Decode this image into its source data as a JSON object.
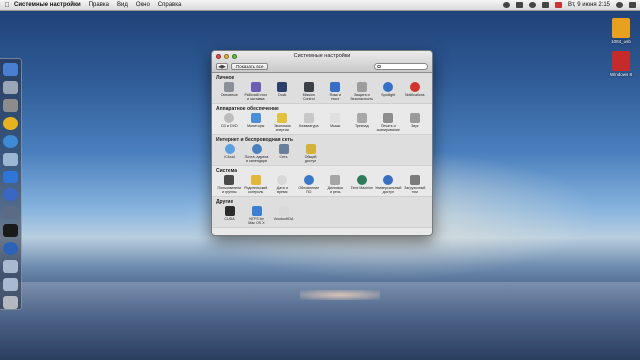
{
  "menubar": {
    "app_name": "Системные настройки",
    "menus": [
      "Правка",
      "Вид",
      "Окно",
      "Справка"
    ],
    "clock": "Вт, 9 июня  2:15"
  },
  "desktop": {
    "items": [
      {
        "label": "1084_usb",
        "icon": "drive-icon",
        "color": "#e8a020"
      },
      {
        "label": "Windows 8",
        "icon": "windows-app-icon",
        "color": "#c62b2b"
      }
    ]
  },
  "dock": {
    "icons": [
      {
        "name": "finder-icon",
        "color": "#4a7fd0"
      },
      {
        "name": "launchpad-icon",
        "color": "#9aa6b6"
      },
      {
        "name": "system-preferences-icon",
        "color": "#8c8c8c"
      },
      {
        "name": "chrome-icon",
        "color": "#e6b21f"
      },
      {
        "name": "safari-icon",
        "color": "#3f8ad4"
      },
      {
        "name": "mail-icon",
        "color": "#9cb7d6"
      },
      {
        "name": "app-store-icon",
        "color": "#2f75d6"
      },
      {
        "name": "itunes-icon",
        "color": "#3a66c4"
      },
      {
        "name": "utilities-icon",
        "color": "#5b6b85"
      },
      {
        "name": "terminal-icon",
        "color": "#1a1a1a"
      },
      {
        "name": "globe-icon",
        "color": "#2d62b6"
      },
      {
        "name": "applications-folder-icon",
        "color": "#a9b9cf"
      },
      {
        "name": "documents-folder-icon",
        "color": "#a9b9cf"
      },
      {
        "name": "trash-icon",
        "color": "#b5b9bf"
      }
    ]
  },
  "window": {
    "title": "Системные настройки",
    "show_all": "Показать все",
    "search_value": "",
    "sections": [
      {
        "title": "Личное",
        "items": [
          {
            "label": "Основные",
            "icon": "general-icon",
            "color": "#8a8f98"
          },
          {
            "label": "Рабочий стол\nи заставка",
            "icon": "desktop-icon",
            "color": "#6b5fb5"
          },
          {
            "label": "Dock",
            "icon": "dock-icon",
            "color": "#2d3f6b"
          },
          {
            "label": "Mission\nControl",
            "icon": "mission-control-icon",
            "color": "#3c3f45"
          },
          {
            "label": "Язык и\nтекст",
            "icon": "flag-icon",
            "color": "#3a6fc8"
          },
          {
            "label": "Защита и\nбезопасность",
            "icon": "house-lock-icon",
            "color": "#9d9d9d"
          },
          {
            "label": "Spotlight",
            "icon": "spotlight-icon",
            "color": "#3570c8"
          },
          {
            "label": "Notifications",
            "icon": "notifications-icon",
            "color": "#d0342c"
          }
        ]
      },
      {
        "title": "Аппаратное обеспечение",
        "items": [
          {
            "label": "CD и DVD",
            "icon": "cd-icon",
            "color": "#bcbcbc"
          },
          {
            "label": "Мониторы",
            "icon": "monitor-icon",
            "color": "#4b8fd6"
          },
          {
            "label": "Экономия\nэнергии",
            "icon": "bulb-icon",
            "color": "#e2c23a"
          },
          {
            "label": "Клавиатура",
            "icon": "keyboard-icon",
            "color": "#c8c8c8"
          },
          {
            "label": "Мышь",
            "icon": "mouse-icon",
            "color": "#e0e0e0"
          },
          {
            "label": "Трекпад",
            "icon": "trackpad-icon",
            "color": "#a8a8a8"
          },
          {
            "label": "Печать и\nсканирование",
            "icon": "printer-icon",
            "color": "#8d8d8d"
          },
          {
            "label": "Звук",
            "icon": "speaker-icon",
            "color": "#9a9a9a"
          }
        ]
      },
      {
        "title": "Интернет и беспроводная сеть",
        "items": [
          {
            "label": "iCloud",
            "icon": "icloud-icon",
            "color": "#5aa0e0"
          },
          {
            "label": "Почта, адреса\nи календари",
            "icon": "at-icon",
            "color": "#4a7fc0"
          },
          {
            "label": "Сеть",
            "icon": "network-icon",
            "color": "#6a7f9c"
          },
          {
            "label": "Общий\nдоступ",
            "icon": "sharing-folder-icon",
            "color": "#d4b23a"
          }
        ]
      },
      {
        "title": "Система",
        "items": [
          {
            "label": "Пользователи\nи группы",
            "icon": "users-icon",
            "color": "#4a4a4a"
          },
          {
            "label": "Родительский\nконтроль",
            "icon": "parental-icon",
            "color": "#e2b83a"
          },
          {
            "label": "Дата и\nвремя",
            "icon": "clock-icon",
            "color": "#d8d8d8"
          },
          {
            "label": "Обновление\nПО",
            "icon": "software-update-icon",
            "color": "#3b78c8"
          },
          {
            "label": "Диктовка\nи речь",
            "icon": "microphone-icon",
            "color": "#a6a6a6"
          },
          {
            "label": "Time Machine",
            "icon": "time-machine-icon",
            "color": "#2f7a5a"
          },
          {
            "label": "Универсальный\nдоступ",
            "icon": "accessibility-icon",
            "color": "#3a70c0"
          },
          {
            "label": "Загрузочный\nтом",
            "icon": "startup-disk-icon",
            "color": "#7b7b7b"
          }
        ]
      },
      {
        "title": "Другие",
        "items": [
          {
            "label": "CUDA",
            "icon": "cuda-icon",
            "color": "#2c2c2c"
          },
          {
            "label": "NTFS for\nMac OS X",
            "icon": "ntfs-icon",
            "color": "#3e7fd2"
          },
          {
            "label": "VoodooHDA",
            "icon": "voodoohda-icon",
            "color": "#d9d9d9"
          }
        ]
      }
    ]
  }
}
